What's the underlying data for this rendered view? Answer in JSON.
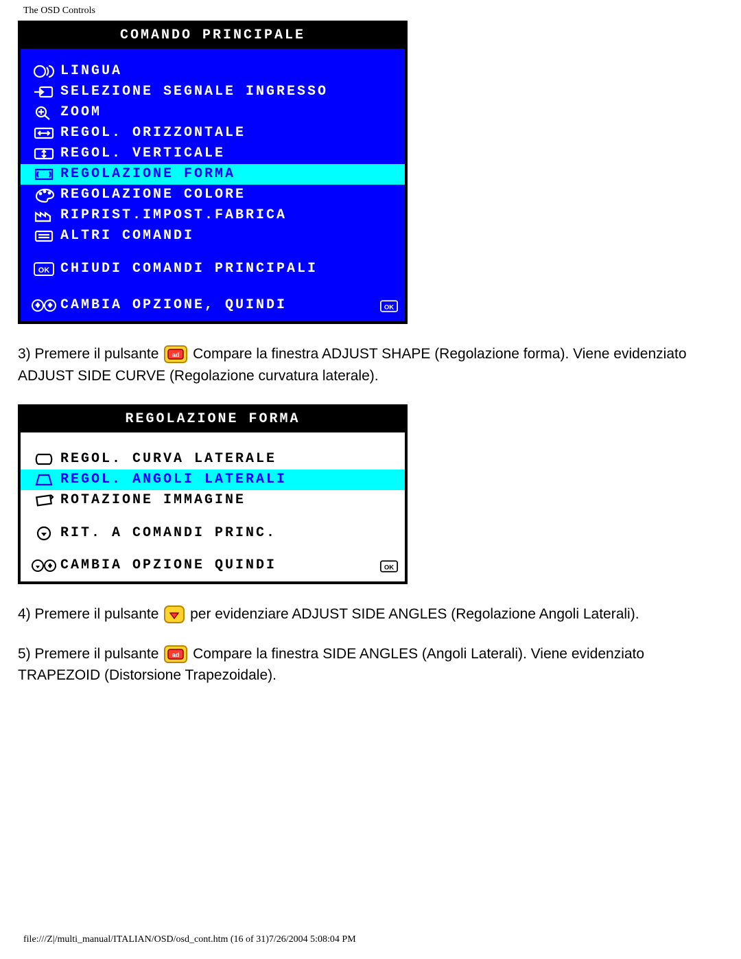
{
  "header_title": "The OSD Controls",
  "osd1": {
    "title": "COMANDO PRINCIPALE",
    "items": [
      {
        "label": "LINGUA",
        "icon": "language-icon",
        "selected": false
      },
      {
        "label": "SELEZIONE SEGNALE INGRESSO",
        "icon": "input-icon",
        "selected": false
      },
      {
        "label": "ZOOM",
        "icon": "zoom-icon",
        "selected": false
      },
      {
        "label": "REGOL. ORIZZONTALE",
        "icon": "horiz-icon",
        "selected": false
      },
      {
        "label": "REGOL. VERTICALE",
        "icon": "vert-icon",
        "selected": false
      },
      {
        "label": "REGOLAZIONE FORMA",
        "icon": "shape-icon",
        "selected": true
      },
      {
        "label": "REGOLAZIONE COLORE",
        "icon": "color-icon",
        "selected": false
      },
      {
        "label": "RIPRIST.IMPOST.FABRICA",
        "icon": "factory-icon",
        "selected": false
      },
      {
        "label": "ALTRI COMANDI",
        "icon": "extra-icon",
        "selected": false
      }
    ],
    "close_label": "CHIUDI COMANDI PRINCIPALI",
    "footer_label": "CAMBIA OPZIONE, QUINDI"
  },
  "para3": {
    "prefix": "3) Premere il pulsante ",
    "suffix": " Compare la finestra ADJUST SHAPE (Regolazione forma). Viene evidenziato ADJUST SIDE CURVE (Regolazione curvatura laterale)."
  },
  "osd2": {
    "title": "REGOLAZIONE FORMA",
    "items": [
      {
        "label": "REGOL. CURVA LATERALE",
        "icon": "barrel-icon",
        "selected": false
      },
      {
        "label": "REGOL. ANGOLI LATERALI",
        "icon": "trapezoid-icon",
        "selected": true
      },
      {
        "label": "ROTAZIONE IMMAGINE",
        "icon": "rotate-icon",
        "selected": false
      }
    ],
    "return_label": "RIT. A COMANDI PRINC.",
    "footer_label": "CAMBIA OPZIONE QUINDI"
  },
  "para4": {
    "prefix": "4) Premere il pulsante ",
    "suffix": " per evidenziare ADJUST SIDE ANGLES (Regolazione Angoli Laterali)."
  },
  "para5": {
    "prefix": "5) Premere il pulsante ",
    "suffix": " Compare la finestra SIDE ANGLES (Angoli Laterali). Viene evidenziato TRAPEZOID (Distorsione Trapezoidale)."
  },
  "footer_path": "file:///Z|/multi_manual/ITALIAN/OSD/osd_cont.htm (16 of 31)7/26/2004 5:08:04 PM"
}
